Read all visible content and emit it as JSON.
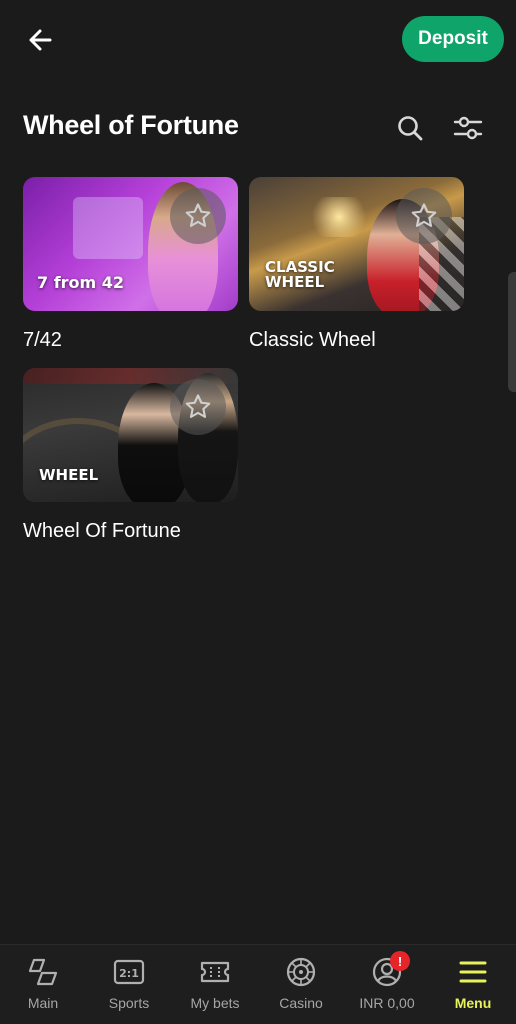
{
  "header": {
    "back_icon": "arrow-left-icon",
    "deposit_label": "Deposit",
    "accent": "#0ea46a"
  },
  "page": {
    "title": "Wheel of Fortune",
    "search_icon": "search-icon",
    "filter_icon": "sliders-icon"
  },
  "games": [
    {
      "name": "7/42",
      "thumb_text": "7 from 42"
    },
    {
      "name": "Classic Wheel",
      "thumb_text_line1": "CLASSIC",
      "thumb_text_line2": "WHEEL"
    },
    {
      "name": "Wheel Of Fortune",
      "thumb_text": "WHEEL"
    }
  ],
  "nav": {
    "items": [
      {
        "label": "Main",
        "icon": "layers-icon"
      },
      {
        "label": "Sports",
        "icon": "scoreboard-icon",
        "icon_text": "2:1"
      },
      {
        "label": "My bets",
        "icon": "ticket-icon"
      },
      {
        "label": "Casino",
        "icon": "roulette-icon"
      },
      {
        "label": "INR 0,00",
        "icon": "user-circle-icon",
        "badge": "!"
      },
      {
        "label": "Menu",
        "icon": "hamburger-icon"
      }
    ],
    "active_color": "#e8f25a"
  }
}
